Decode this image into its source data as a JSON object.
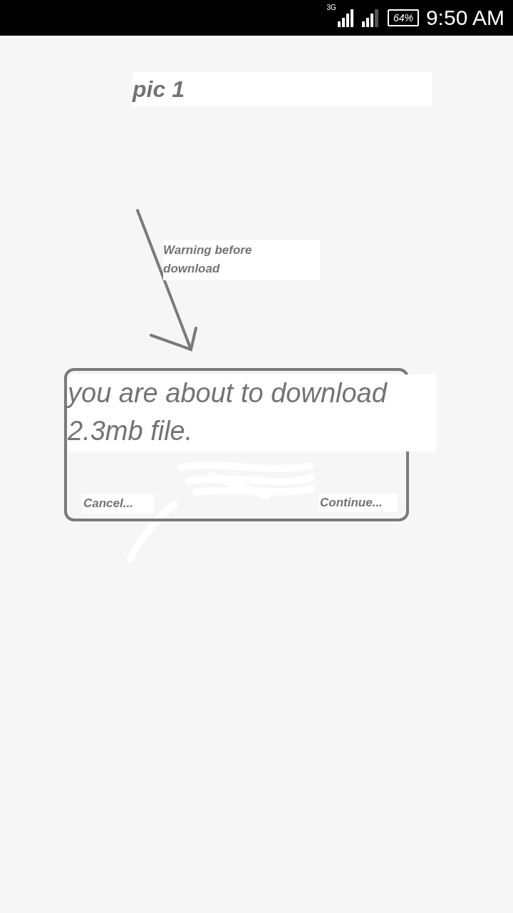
{
  "status_bar": {
    "network": "3G",
    "battery": "64%",
    "time": "9:50 AM"
  },
  "title": "pic 1",
  "note": "Warning before download",
  "dialog": {
    "message": "you are about to download 2.3mb file.",
    "buttons": [
      "Cancel...",
      "Continue..."
    ]
  }
}
